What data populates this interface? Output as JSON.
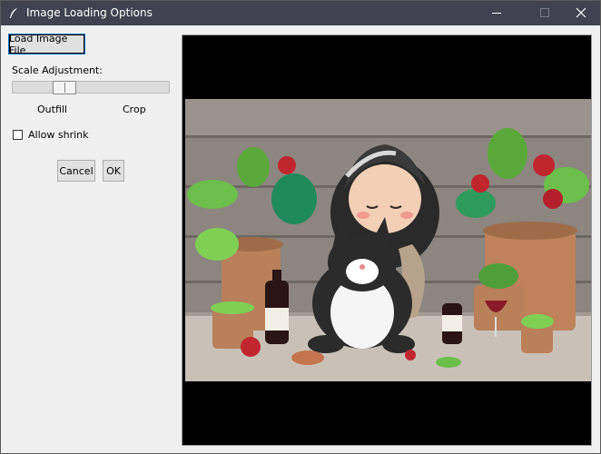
{
  "window": {
    "title": "Image Loading Options"
  },
  "controls": {
    "load_button": "Load Image File",
    "scale_label": "Scale Adjustment:",
    "scale_value": 0.3,
    "outfill_label": "Outfill",
    "crop_label": "Crop",
    "allow_shrink_label": "Allow shrink",
    "allow_shrink_checked": false,
    "cancel_button": "Cancel",
    "ok_button": "OK"
  },
  "icons": {
    "app": "feather-icon",
    "minimize": "minimize-icon",
    "maximize": "maximize-icon",
    "close": "close-icon"
  },
  "colors": {
    "titlebar": "#40434f",
    "canvas_bg": "#000000"
  }
}
